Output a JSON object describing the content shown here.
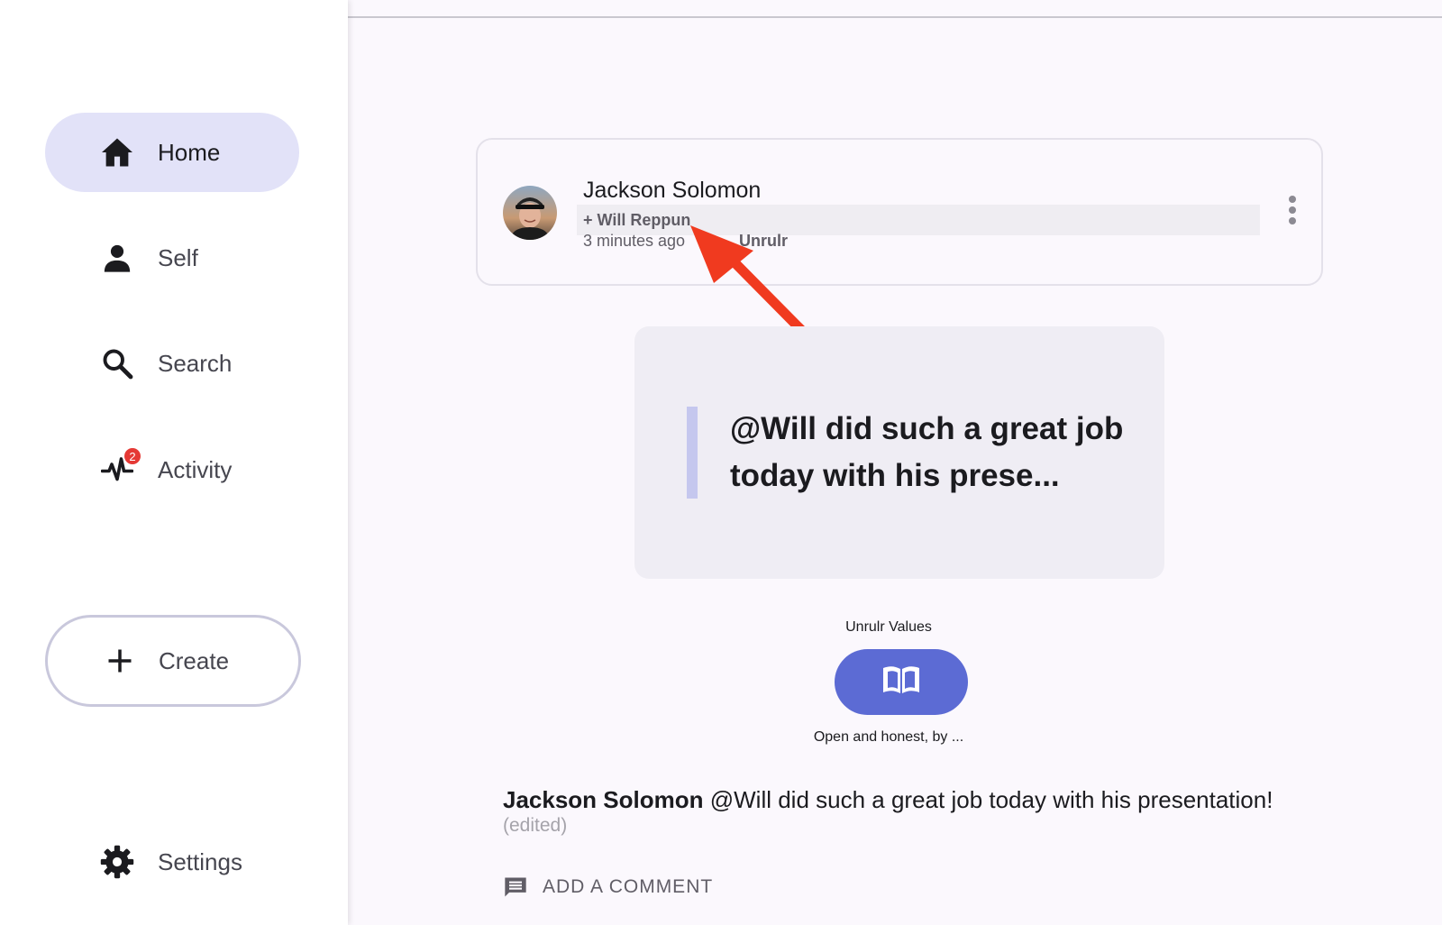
{
  "sidebar": {
    "items": [
      {
        "label": "Home",
        "icon": "home-icon",
        "active": true
      },
      {
        "label": "Self",
        "icon": "person-icon",
        "active": false
      },
      {
        "label": "Search",
        "icon": "search-icon",
        "active": false
      },
      {
        "label": "Activity",
        "icon": "activity-icon",
        "active": false,
        "badge": "2"
      }
    ],
    "create_label": "Create",
    "settings_label": "Settings"
  },
  "post": {
    "author": "Jackson Solomon",
    "tagged": "+ Will Reppun",
    "time": "3 minutes ago",
    "org": "Unrulr",
    "quote": "@Will did such a great job today with his prese...",
    "values_label": "Unrulr Values",
    "values_caption": "Open and honest, by ...",
    "caption_author": "Jackson Solomon",
    "caption_text": "@Will did such a great job today with his presentation!",
    "edited": "(edited)",
    "comment_label": "ADD A COMMENT"
  },
  "colors": {
    "accent": "#5c6bd4",
    "active_nav": "#e2e2f8",
    "badge": "#e53935",
    "annotation_arrow": "#f03a1f"
  }
}
